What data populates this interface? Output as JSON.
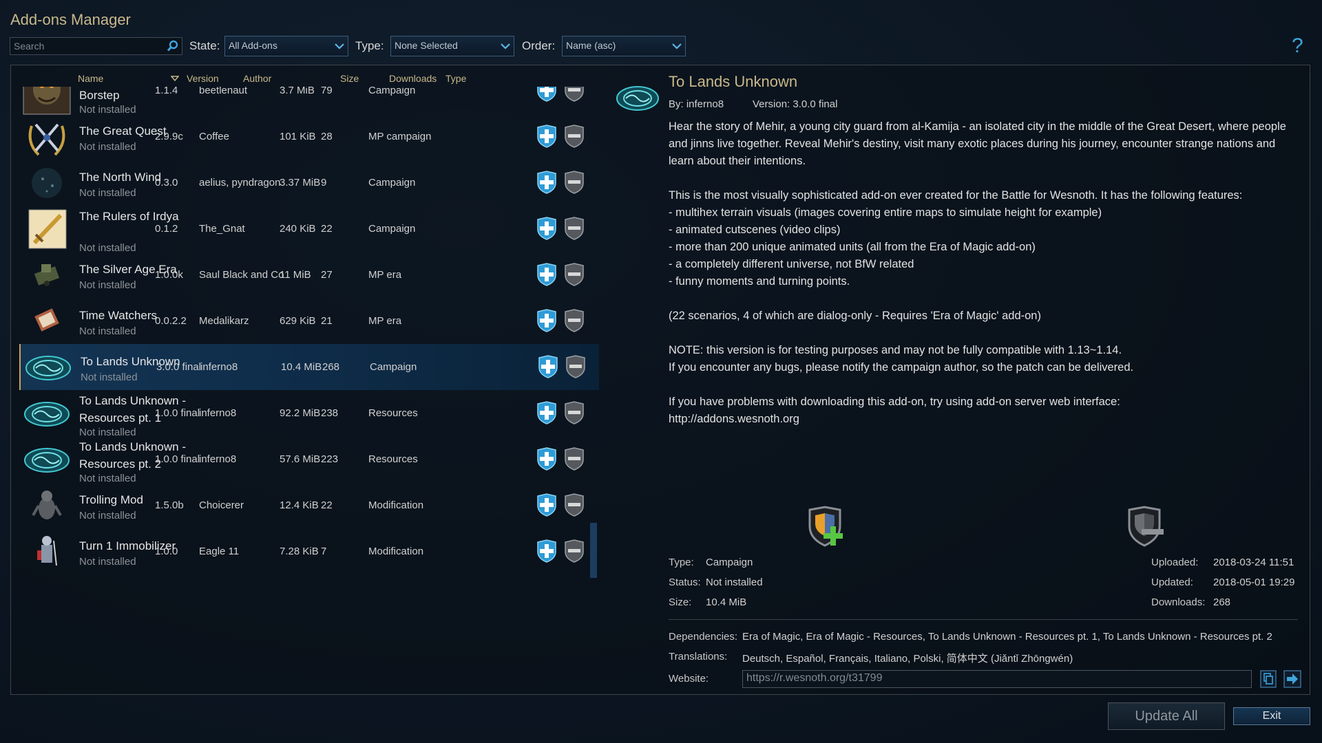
{
  "window": {
    "title": "Add-ons Manager"
  },
  "filters": {
    "search_placeholder": "Search",
    "state_label": "State:",
    "state_value": "All Add-ons",
    "type_label": "Type:",
    "type_value": "None Selected",
    "order_label": "Order:",
    "order_value": "Name (asc)",
    "help": "?"
  },
  "columns": {
    "name": "Name",
    "version": "Version",
    "author": "Author",
    "size": "Size",
    "downloads": "Downloads",
    "type": "Type"
  },
  "addons": [
    {
      "name": "The Founding of Borstep",
      "status": "Not installed",
      "version": "1.1.4",
      "author": "beetlenaut",
      "size": "3.7 MiB",
      "downloads": "79",
      "type": "Campaign",
      "icon": "troll-portrait-icon"
    },
    {
      "name": "The Great Quest",
      "status": "Not installed",
      "version": "2.9.9c",
      "author": "Coffee",
      "size": "101 KiB",
      "downloads": "28",
      "type": "MP campaign",
      "icon": "crossed-swords-laurel-icon"
    },
    {
      "name": "The North Wind",
      "status": "Not installed",
      "version": "0.3.0",
      "author": "aelius, pyndragon",
      "size": "3.37 MiB",
      "downloads": "9",
      "type": "Campaign",
      "icon": "dark-wind-icon"
    },
    {
      "name": "The Rulers of Irdya",
      "status": "Not installed",
      "version": "0.1.2",
      "author": "The_Gnat",
      "size": "240 KiB",
      "downloads": "22",
      "type": "Campaign",
      "icon": "golden-sword-icon"
    },
    {
      "name": "The Silver Age Era",
      "status": "Not installed",
      "version": "1.0.0k",
      "author": "Saul Black and Co",
      "size": "11 MiB",
      "downloads": "27",
      "type": "MP era",
      "icon": "tank-unit-icon"
    },
    {
      "name": "Time Watchers",
      "status": "Not installed",
      "version": "0.0.2.2",
      "author": "Medalikarz",
      "size": "629 KiB",
      "downloads": "21",
      "type": "MP era",
      "icon": "book-unit-icon"
    },
    {
      "name": "To Lands Unknown",
      "status": "Not installed",
      "version": "3.0.0 final",
      "author": "inferno8",
      "size": "10.4 MiB",
      "downloads": "268",
      "type": "Campaign",
      "icon": "cyan-rune-disc-icon"
    },
    {
      "name": "To Lands Unknown - Resources pt. 1",
      "status": "Not installed",
      "version": "1.0.0 final",
      "author": "inferno8",
      "size": "92.2 MiB",
      "downloads": "238",
      "type": "Resources",
      "icon": "cyan-rune-disc-icon"
    },
    {
      "name": "To Lands Unknown - Resources pt. 2",
      "status": "Not installed",
      "version": "1.0.0 final",
      "author": "inferno8",
      "size": "57.6 MiB",
      "downloads": "223",
      "type": "Resources",
      "icon": "cyan-rune-disc-icon"
    },
    {
      "name": "Trolling Mod",
      "status": "Not installed",
      "version": "1.5.0b",
      "author": "Choicerer",
      "size": "12.4 KiB",
      "downloads": "22",
      "type": "Modification",
      "icon": "troll-unit-icon"
    },
    {
      "name": "Turn 1 Immobilizer",
      "status": "Not installed",
      "version": "1.0.0",
      "author": "Eagle 11",
      "size": "7.28 KiB",
      "downloads": "7",
      "type": "Modification",
      "icon": "knight-unit-icon"
    }
  ],
  "details": {
    "title": "To Lands Unknown",
    "by": "By: inferno8",
    "version": "Version: 3.0.0 final",
    "description": [
      "Hear the story of Mehir, a young city guard from al-Kamija - an isolated city in the middle of the Great Desert, where people and jinns live together. Reveal Mehir's destiny, visit many exotic places during his journey, encounter strange nations and learn about their intentions.",
      "",
      "This is the most visually sophisticated add-on ever created for the Battle for Wesnoth. It has the following features:",
      "- multihex terrain visuals (images covering entire maps to simulate height for example)",
      "- animated cutscenes (video clips)",
      "- more than 200 unique animated units (all from the Era of Magic add-on)",
      "- a completely different universe, not BfW related",
      "- funny moments and turning points.",
      "",
      "(22 scenarios, 4 of which are dialog-only - Requires 'Era of Magic' add-on)",
      "",
      "NOTE: this version is for testing purposes and may not be fully compatible with 1.13~1.14.",
      "If you encounter any bugs, please notify the campaign author, so the patch can be delivered.",
      "",
      "If you have problems with downloading this add-on, try using add-on server web interface:",
      "http://addons.wesnoth.org"
    ],
    "type_label": "Type:",
    "type_value": "Campaign",
    "status_label": "Status:",
    "status_value": "Not installed",
    "size_label": "Size:",
    "size_value": "10.4 MiB",
    "uploaded_label": "Uploaded:",
    "uploaded_value": "2018-03-24 11:51",
    "updated_label": "Updated:",
    "updated_value": "2018-05-01 19:29",
    "downloads_label": "Downloads:",
    "downloads_value": "268",
    "dependencies_label": "Dependencies:",
    "dependencies_value": "Era of Magic, Era of Magic - Resources, To Lands Unknown - Resources pt. 1, To Lands Unknown - Resources pt. 2",
    "translations_label": "Translations:",
    "translations_value": "Deutsch, Español, Français, Italiano, Polski, 简体中文 (Jiǎntǐ Zhōngwén)",
    "website_label": "Website:",
    "website_value": "https://r.wesnoth.org/t31799"
  },
  "buttons": {
    "update_all": "Update All",
    "exit": "Exit"
  },
  "colors": {
    "accent_gold": "#c8b88a",
    "install_blue": "#3fb4e8",
    "selection": "#12324f"
  }
}
